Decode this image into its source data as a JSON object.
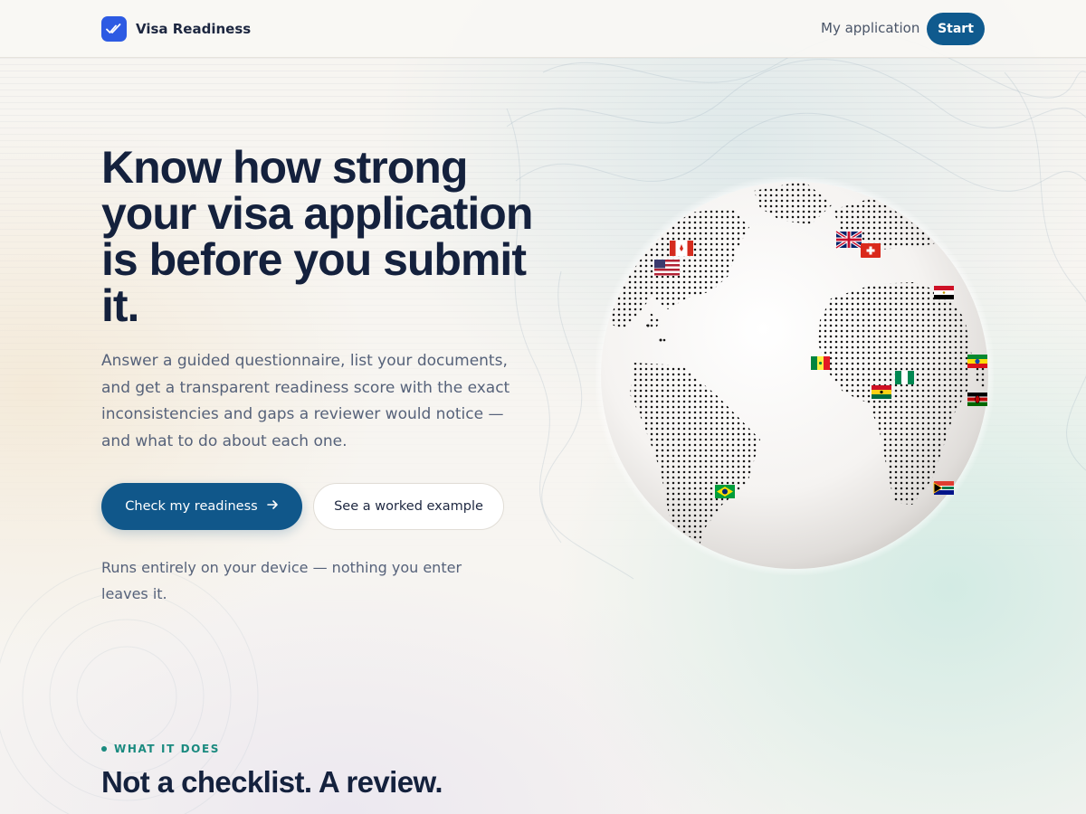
{
  "header": {
    "brand_name": "Visa Readiness",
    "nav_link": "My application",
    "start_label": "Start"
  },
  "hero": {
    "title": "Know how strong your visa application is before you submit it.",
    "subtitle": "Answer a guided questionnaire, list your documents, and get a transparent readiness score with the exact inconsistencies and gaps a reviewer would notice — and what to do about each one.",
    "primary_cta": "Check my readiness",
    "secondary_cta": "See a worked example",
    "privacy_note": "Runs entirely on your device — nothing you enter leaves it."
  },
  "section": {
    "eyebrow": "WHAT IT DOES",
    "title": "Not a checklist. A review."
  },
  "globe": {
    "flags": [
      "canada-flag",
      "usa-flag",
      "uk-flag",
      "switzerland-flag",
      "egypt-flag",
      "senegal-flag",
      "nigeria-flag",
      "ghana-flag",
      "ethiopia-flag",
      "kenya-flag",
      "south-africa-flag",
      "brazil-flag"
    ]
  },
  "colors": {
    "brand_blue": "#2d5be3",
    "primary": "#10578a",
    "eyebrow_teal": "#1a8a7f",
    "heading": "#14213d",
    "body": "#56627a"
  }
}
